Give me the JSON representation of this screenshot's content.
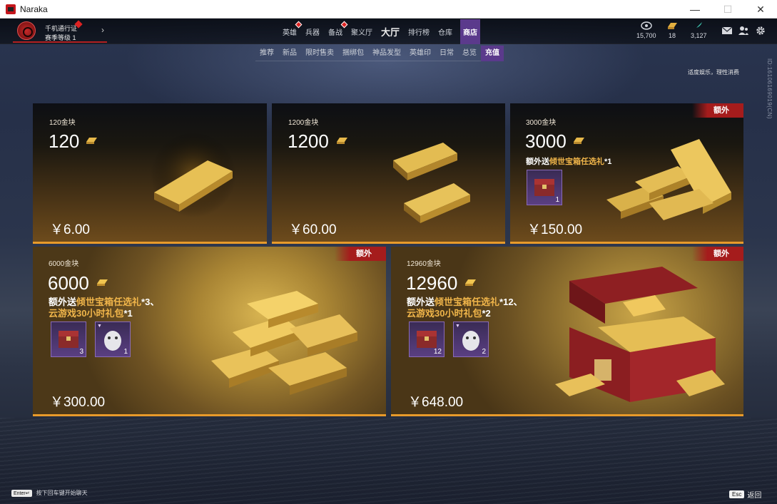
{
  "window": {
    "title": "Naraka",
    "minimize": "—",
    "maximize": "☐",
    "close": "✕"
  },
  "profile": {
    "pass": "千机通行证",
    "level": "赛季等级 1"
  },
  "mainnav": [
    {
      "label": "英雄",
      "dot": true
    },
    {
      "label": "兵器",
      "dot": false
    },
    {
      "label": "备战",
      "dot": true
    },
    {
      "label": "聚义厅",
      "dot": false
    },
    {
      "label": "大厅",
      "dot": false
    },
    {
      "label": "排行榜",
      "dot": false
    },
    {
      "label": "仓库",
      "dot": false
    },
    {
      "label": "商店",
      "dot": false
    }
  ],
  "currency": {
    "c1": {
      "value": "15,700",
      "icon": "coin-icon"
    },
    "c2": {
      "value": "18",
      "icon": "gold-bar-icon"
    },
    "c3": {
      "value": "3,127",
      "icon": "feather-icon"
    }
  },
  "subtabs": [
    "推荐",
    "新品",
    "限时售卖",
    "捆绑包",
    "神品发型",
    "英雄印",
    "日常",
    "总览",
    "充值"
  ],
  "notice": "适度娱乐，理性消费",
  "side_id": "ID:16106169019(CN)",
  "cards": [
    {
      "name": "120金块",
      "amount": "120",
      "price": "￥6.00"
    },
    {
      "name": "1200金块",
      "amount": "1200",
      "price": "￥60.00"
    },
    {
      "name": "3000金块",
      "amount": "3000",
      "price": "￥150.00",
      "tag": "额外",
      "bonus_pre": "额外送",
      "bonus_hl": "倾世宝箱任选礼",
      "bonus_post": "*1",
      "rewards": [
        "1"
      ]
    },
    {
      "name": "6000金块",
      "amount": "6000",
      "price": "￥300.00",
      "tag": "额外",
      "bonus_pre": "额外送",
      "bonus_hl": "倾世宝箱任选礼",
      "bonus_post": "*3、",
      "bonus2_hl": "云游戏30小时礼包",
      "bonus2_post": "*1",
      "rewards": [
        "3",
        "1"
      ]
    },
    {
      "name": "12960金块",
      "amount": "12960",
      "price": "￥648.00",
      "tag": "额外",
      "bonus_pre": "额外送",
      "bonus_hl": "倾世宝箱任选礼",
      "bonus_post": "*12、",
      "bonus2_hl": "云游戏30小时礼包",
      "bonus2_post": "*2",
      "rewards": [
        "12",
        "2"
      ]
    }
  ],
  "hints": {
    "enter_key": "Enter↵",
    "enter_text": "按下回车键开始聊天",
    "esc_key": "Esc",
    "esc_text": "返回"
  },
  "colors": {
    "accent_purple": "#5b3a8c",
    "price_bar": "#e89a2a",
    "extra_tag": "#a51c1c",
    "bonus_highlight": "#f0b54a"
  }
}
